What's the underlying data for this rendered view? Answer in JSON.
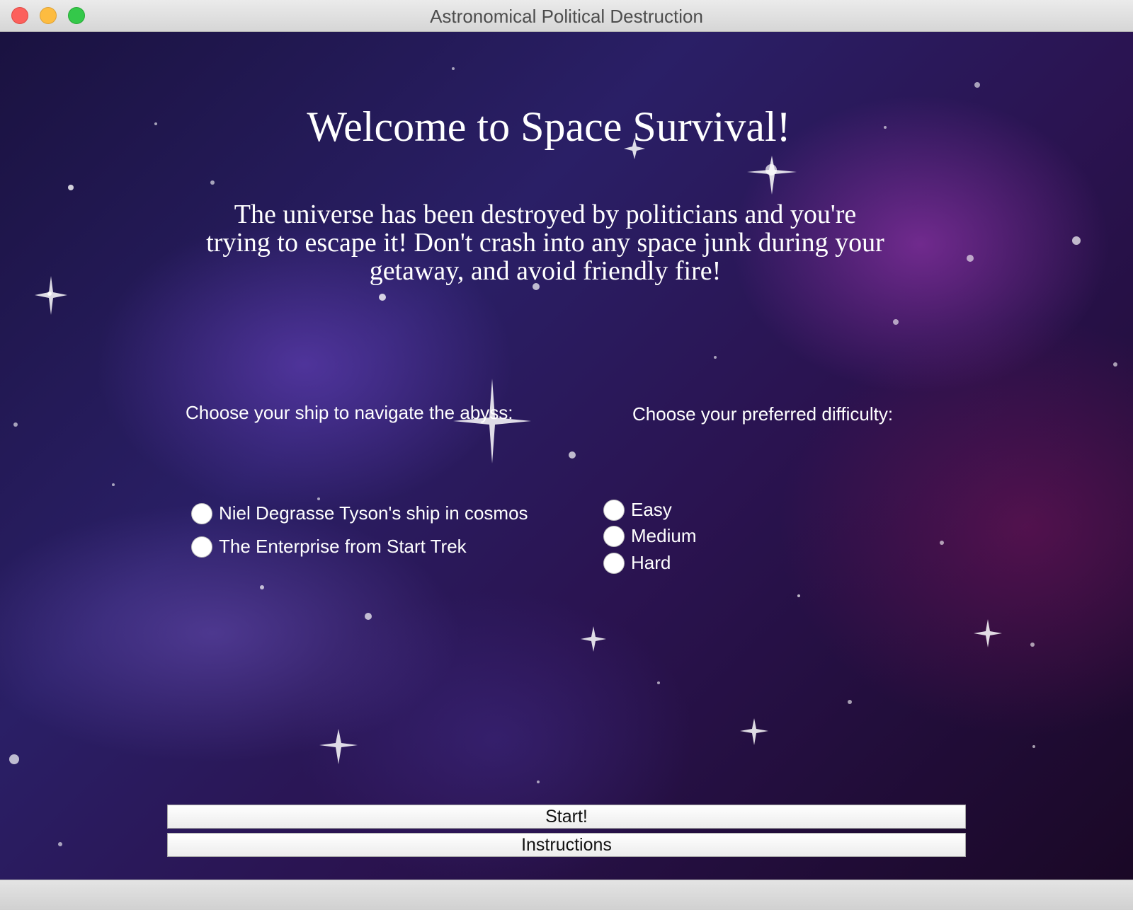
{
  "window": {
    "title": "Astronomical Political Destruction"
  },
  "main": {
    "heading": "Welcome to Space Survival!",
    "intro": "The universe has been destroyed by politicians and you're trying to escape it! Don't crash into any space junk during your getaway, and avoid friendly fire!",
    "ship_prompt": "Choose your ship to navigate the abyss:",
    "difficulty_prompt": "Choose your preferred difficulty:",
    "ships": [
      {
        "label": "Niel Degrasse Tyson's ship in cosmos",
        "selected": false
      },
      {
        "label": "The Enterprise from Start Trek",
        "selected": false
      }
    ],
    "difficulties": [
      {
        "label": "Easy",
        "selected": false
      },
      {
        "label": "Medium",
        "selected": false
      },
      {
        "label": "Hard",
        "selected": false
      }
    ],
    "start_label": "Start!",
    "instructions_label": "Instructions"
  },
  "colors": {
    "close": "#fc605c",
    "minimize": "#fdbc40",
    "maximize": "#34c84a"
  }
}
